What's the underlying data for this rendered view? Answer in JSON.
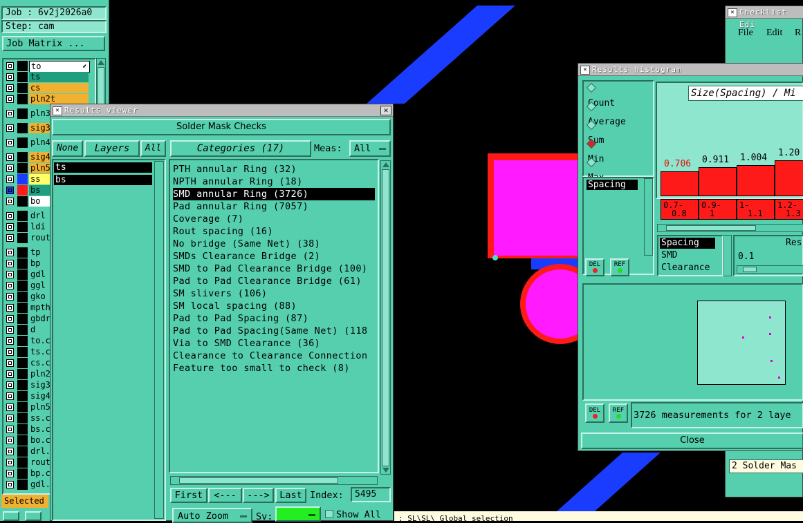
{
  "left_panel": {
    "job_label": "Job : 6v2j2026a0",
    "step_label": "Step: cam",
    "job_matrix_button": "Job Matrix ...",
    "selected_label": "Selected",
    "layers": [
      {
        "name": "to",
        "swatch": "#000000",
        "bg": "#ffffff",
        "arrow": true
      },
      {
        "name": "ts",
        "swatch": "#000000",
        "bg": "#1f9f7f"
      },
      {
        "name": "cs",
        "swatch": "#000000",
        "bg": "#f0b030"
      },
      {
        "name": "pln2t",
        "swatch": "#000000",
        "bg": "#f0b030"
      },
      {
        "name": "pln3",
        "swatch": "#000000",
        "bg": "#56cfae"
      },
      {
        "name": "sig3",
        "swatch": "#000000",
        "bg": "#f0b030"
      },
      {
        "name": "pln4",
        "swatch": "#000000",
        "bg": "#56cfae"
      },
      {
        "name": "sig4",
        "swatch": "#000000",
        "bg": "#f0b030"
      },
      {
        "name": "pln5",
        "swatch": "#000000",
        "bg": "#f0b030"
      },
      {
        "name": "ss",
        "swatch": "#1a3cff",
        "bg": "#ffff66"
      },
      {
        "name": "bs",
        "swatch": "#ff1a1a",
        "bg": "#1f9f7f",
        "blue_check": true
      },
      {
        "name": "bo",
        "swatch": "#000000",
        "bg": "#ffffff"
      },
      {
        "name": "drl",
        "swatch": "#000000",
        "bg": "#56cfae"
      },
      {
        "name": "ldi",
        "swatch": "#000000",
        "bg": "#56cfae"
      },
      {
        "name": "rout",
        "swatch": "#000000",
        "bg": "#56cfae"
      },
      {
        "name": "tp",
        "swatch": "#000000",
        "bg": "#56cfae"
      },
      {
        "name": "bp",
        "swatch": "#000000",
        "bg": "#56cfae"
      },
      {
        "name": "gdl",
        "swatch": "#000000",
        "bg": "#56cfae"
      },
      {
        "name": "ggl",
        "swatch": "#000000",
        "bg": "#56cfae"
      },
      {
        "name": "gko",
        "swatch": "#000000",
        "bg": "#56cfae"
      },
      {
        "name": "mpth",
        "swatch": "#000000",
        "bg": "#56cfae"
      },
      {
        "name": "gbdr",
        "swatch": "#000000",
        "bg": "#56cfae"
      },
      {
        "name": "d",
        "swatch": "#000000",
        "bg": "#56cfae"
      },
      {
        "name": "to.c",
        "swatch": "#000000",
        "bg": "#56cfae"
      },
      {
        "name": "ts.c",
        "swatch": "#000000",
        "bg": "#56cfae"
      },
      {
        "name": "cs.c",
        "swatch": "#000000",
        "bg": "#56cfae"
      },
      {
        "name": "pln2",
        "swatch": "#000000",
        "bg": "#56cfae"
      },
      {
        "name": "sig3",
        "swatch": "#000000",
        "bg": "#56cfae"
      },
      {
        "name": "sig4",
        "swatch": "#000000",
        "bg": "#56cfae"
      },
      {
        "name": "pln5",
        "swatch": "#000000",
        "bg": "#56cfae"
      },
      {
        "name": "ss.c",
        "swatch": "#000000",
        "bg": "#56cfae"
      },
      {
        "name": "bs.c",
        "swatch": "#000000",
        "bg": "#56cfae"
      },
      {
        "name": "bo.c",
        "swatch": "#000000",
        "bg": "#56cfae"
      },
      {
        "name": "drl.",
        "swatch": "#000000",
        "bg": "#56cfae"
      },
      {
        "name": "rout",
        "swatch": "#000000",
        "bg": "#56cfae"
      },
      {
        "name": "bp.c",
        "swatch": "#000000",
        "bg": "#56cfae"
      },
      {
        "name": "gdl.",
        "swatch": "#000000",
        "bg": "#56cfae"
      }
    ]
  },
  "results_viewer": {
    "title": "Results viewer",
    "header": "Solder Mask Checks",
    "none_button": "None",
    "layers_label": "Layers",
    "all_button": "All",
    "layers": [
      "ts",
      "bs"
    ],
    "categories_label": "Categories (17)",
    "meas_label": "Meas:",
    "meas_value": "All",
    "categories": [
      "PTH annular Ring (32)",
      "NPTH annular Ring (18)",
      "SMD annular Ring (3726)",
      "Pad annular Ring (7057)",
      "Coverage (7)",
      "Rout spacing (16)",
      "No bridge (Same Net) (38)",
      "SMDs Clearance Bridge (2)",
      "SMD to Pad Clearance Bridge (100)",
      "Pad to Pad Clearance Bridge (61)",
      "SM slivers (106)",
      "SM local spacing (88)",
      "Pad to Pad Spacing (87)",
      "Pad to Pad Spacing(Same Net) (118",
      "Via to SMD Clearance (36)",
      "Clearance to Clearance Connection",
      "Feature too small to check (8)"
    ],
    "selected_index": 2,
    "first_button": "First",
    "prev_button": "<---",
    "next_button": "--->",
    "last_button": "Last",
    "index_label": "Index:",
    "index_value": "5495",
    "auto_zoom": "Auto Zoom",
    "sv_label": "Sv:",
    "show_all": "Show All"
  },
  "histogram": {
    "title": "Results histogram",
    "options": [
      "Count",
      "Average",
      "Sum",
      "Min",
      "Max"
    ],
    "selected_option": "Min",
    "list_item": "Spacing",
    "chart_title": "Size(Spacing) / Mi",
    "bar_values": [
      "0.706",
      "0.911",
      "1.004",
      "1.20"
    ],
    "bar_heights": [
      0.706,
      0.911,
      1.004,
      1.2
    ],
    "bar_ranges": [
      [
        "0.7-",
        "0.8"
      ],
      [
        "0.9-",
        "1"
      ],
      [
        "1-",
        "1.1"
      ],
      [
        "1.2-",
        "1.3"
      ]
    ],
    "spacing_list": [
      "Spacing",
      "SMD",
      "Clearance"
    ],
    "res_label": "Res",
    "res_value": "0.1",
    "del_label": "DEL",
    "ref_label": "REF",
    "status": "3726 measurements for 2 laye",
    "close_button": "Close"
  },
  "checklist": {
    "title": "Checklist Edi",
    "menu": [
      "File",
      "Edit",
      "R"
    ],
    "item": "2 Solder Mas"
  },
  "status_line": ": SL\\SL\\ Global selection",
  "colors": {
    "teal": "#56cfae",
    "blue": "#1a3cff",
    "red": "#ff1a1a",
    "magenta": "#ff1aff"
  }
}
